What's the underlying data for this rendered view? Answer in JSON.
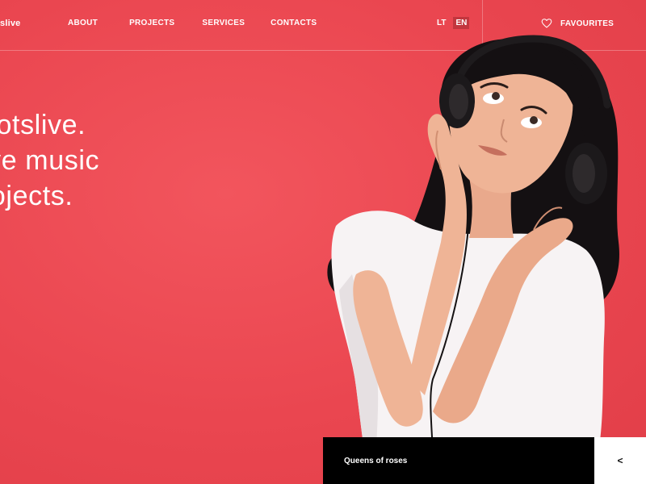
{
  "brand": {
    "logo_text": "slive"
  },
  "nav": {
    "items": [
      {
        "label": "ABOUT"
      },
      {
        "label": "PROJECTS"
      },
      {
        "label": "SERVICES"
      },
      {
        "label": "CONTACTS"
      }
    ]
  },
  "languages": {
    "options": [
      "LT",
      "EN"
    ],
    "active": "EN"
  },
  "favourites": {
    "label": "FAVOURITES",
    "icon": "heart-outline-icon"
  },
  "hero": {
    "lines": [
      "ootslive.",
      "ive music",
      "rojects."
    ]
  },
  "player": {
    "track_title": "Queens of roses",
    "prev_label": "<"
  },
  "colors": {
    "background": "#ea4650",
    "accent_dark": "#c2363e",
    "player_bg": "#000000",
    "text": "#ffffff"
  }
}
